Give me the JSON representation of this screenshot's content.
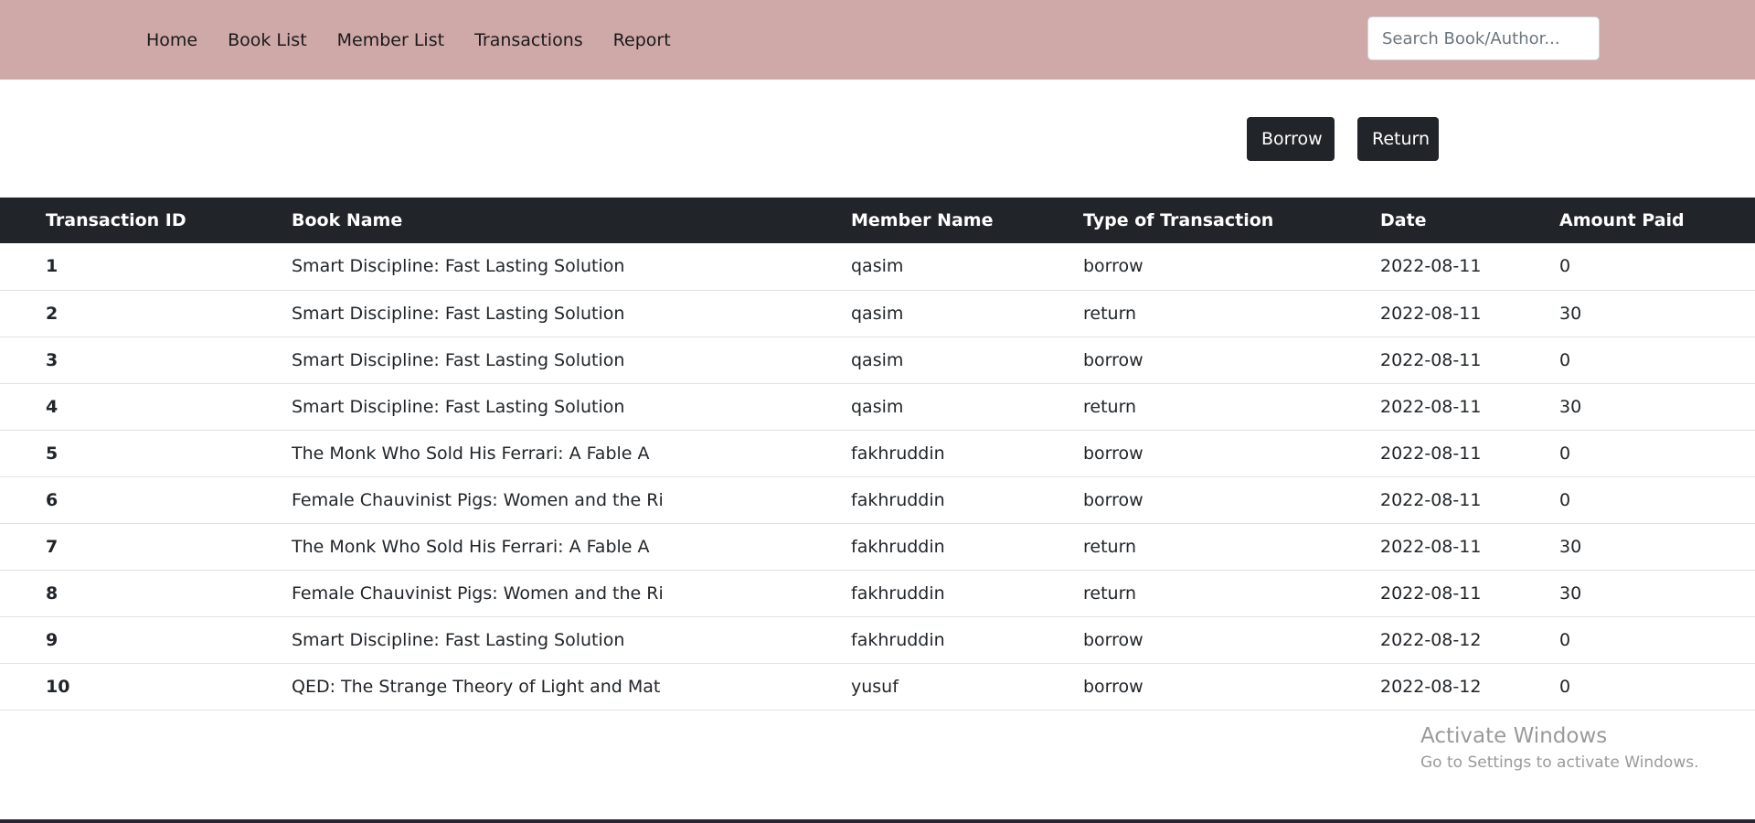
{
  "nav": {
    "items": [
      "Home",
      "Book List",
      "Member List",
      "Transactions",
      "Report"
    ]
  },
  "search": {
    "placeholder": "Search Book/Author..."
  },
  "actions": {
    "borrow_label": "Borrow",
    "return_label": "Return"
  },
  "table": {
    "headers": [
      "Transaction ID",
      "Book Name",
      "Member Name",
      "Type of Transaction",
      "Date",
      "Amount Paid"
    ],
    "rows": [
      [
        "1",
        "Smart Discipline: Fast Lasting Solution",
        "qasim",
        "borrow",
        "2022-08-11",
        "0"
      ],
      [
        "2",
        "Smart Discipline: Fast Lasting Solution",
        "qasim",
        "return",
        "2022-08-11",
        "30"
      ],
      [
        "3",
        "Smart Discipline: Fast Lasting Solution",
        "qasim",
        "borrow",
        "2022-08-11",
        "0"
      ],
      [
        "4",
        "Smart Discipline: Fast Lasting Solution",
        "qasim",
        "return",
        "2022-08-11",
        "30"
      ],
      [
        "5",
        "The Monk Who Sold His Ferrari: A Fable A",
        "fakhruddin",
        "borrow",
        "2022-08-11",
        "0"
      ],
      [
        "6",
        "Female Chauvinist Pigs: Women and the Ri",
        "fakhruddin",
        "borrow",
        "2022-08-11",
        "0"
      ],
      [
        "7",
        "The Monk Who Sold His Ferrari: A Fable A",
        "fakhruddin",
        "return",
        "2022-08-11",
        "30"
      ],
      [
        "8",
        "Female Chauvinist Pigs: Women and the Ri",
        "fakhruddin",
        "return",
        "2022-08-11",
        "30"
      ],
      [
        "9",
        "Smart Discipline: Fast Lasting Solution",
        "fakhruddin",
        "borrow",
        "2022-08-12",
        "0"
      ],
      [
        "10",
        "QED: The Strange Theory of Light and Mat",
        "yusuf",
        "borrow",
        "2022-08-12",
        "0"
      ]
    ]
  },
  "watermark": {
    "title": "Activate Windows",
    "subtitle": "Go to Settings to activate Windows."
  },
  "colors": {
    "navbar_bg": "#cfa8a8",
    "dark": "#212529"
  }
}
